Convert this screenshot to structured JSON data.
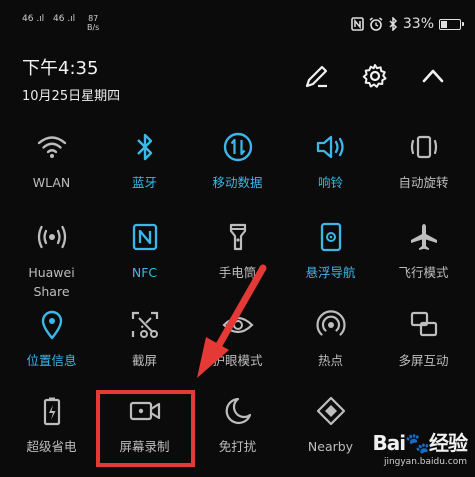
{
  "status": {
    "signal1": "46 .ıl",
    "signal2": "46 .ıl",
    "net_speed_value": "87",
    "net_speed_unit": "B/s",
    "battery_percent": "33%",
    "battery_level": 0.33,
    "icons": [
      "nfc-icon",
      "alarm-icon",
      "bluetooth-icon",
      "battery-icon"
    ]
  },
  "header": {
    "time": "下午4:35",
    "date": "10月25日星期四",
    "actions": [
      "edit-icon",
      "settings-icon",
      "collapse-icon"
    ]
  },
  "colors": {
    "active": "#3bb8e8",
    "inactive": "#bdbdbd",
    "highlight": "#e53935"
  },
  "tiles": [
    {
      "label": "WLAN",
      "icon": "wifi-icon",
      "active": false
    },
    {
      "label": "蓝牙",
      "icon": "bluetooth-icon",
      "active": true
    },
    {
      "label": "移动数据",
      "icon": "mobile-data-icon",
      "active": true
    },
    {
      "label": "响铃",
      "icon": "ring-icon",
      "active": true
    },
    {
      "label": "自动旋转",
      "icon": "auto-rotate-icon",
      "active": false
    },
    {
      "label": "Huawei Share",
      "label_line1": "Huawei",
      "label_line2": "Share",
      "icon": "huawei-share-icon",
      "active": false
    },
    {
      "label": "NFC",
      "icon": "nfc-icon",
      "active": true
    },
    {
      "label": "手电筒",
      "icon": "flashlight-icon",
      "active": false
    },
    {
      "label": "悬浮导航",
      "icon": "floating-nav-icon",
      "active": true
    },
    {
      "label": "飞行模式",
      "icon": "airplane-icon",
      "active": false
    },
    {
      "label": "位置信息",
      "icon": "location-icon",
      "active": true
    },
    {
      "label": "截屏",
      "icon": "screenshot-icon",
      "active": false
    },
    {
      "label": "护眼模式",
      "icon": "eye-comfort-icon",
      "active": false
    },
    {
      "label": "热点",
      "icon": "hotspot-icon",
      "active": false
    },
    {
      "label": "多屏互动",
      "icon": "multi-screen-icon",
      "active": false
    },
    {
      "label": "超级省电",
      "icon": "power-saving-icon",
      "active": false
    },
    {
      "label": "屏幕录制",
      "icon": "screen-record-icon",
      "active": false
    },
    {
      "label": "免打扰",
      "icon": "do-not-disturb-icon",
      "active": false
    },
    {
      "label": "Nearby",
      "icon": "nearby-icon",
      "active": false
    }
  ],
  "watermark": {
    "logo": "Bai du 经验",
    "logo_part1": "Bai",
    "logo_part2": "经验",
    "url": "jingyan.baidu.com"
  }
}
